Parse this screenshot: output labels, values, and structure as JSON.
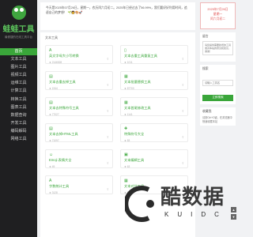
{
  "app": {
    "logo_text": "蛙蛙工具",
    "logo_sub": "最便捷的在线工具平台"
  },
  "sidebar": {
    "items": [
      {
        "label": "首页",
        "active": true
      },
      {
        "label": "文本工具"
      },
      {
        "label": "图片工具"
      },
      {
        "label": "视频工具"
      },
      {
        "label": "运维工具"
      },
      {
        "label": "计算工具"
      },
      {
        "label": "转换工具"
      },
      {
        "label": "图表工具"
      },
      {
        "label": "数据查询"
      },
      {
        "label": "开发工具"
      },
      {
        "label": "编码解码"
      },
      {
        "label": "网络工具"
      }
    ]
  },
  "notice": {
    "text": "今天是2025年07月26日，星期一，农历闰六月初二。2025年已经过去了56.99%，我们要好好利用时间，追逐自己的梦想！",
    "emoji": "🌱🧑🎨🚀"
  },
  "tools": {
    "section_title": "文本工具",
    "cards": [
      {
        "icon": "A",
        "icon_name": "font-icon",
        "title": "英文字母大小写转换",
        "stat": "★ 2146528"
      },
      {
        "icon": "▯",
        "icon_name": "document-icon",
        "title": "文本去重工具重复工具",
        "stat": "★ 1011"
      },
      {
        "icon": "▤",
        "icon_name": "list-icon",
        "title": "文本去重去掉工具",
        "stat": "★ 1944"
      },
      {
        "icon": "▦",
        "icon_name": "table-icon",
        "title": "文本批量替换工具",
        "stat": "★ 87700"
      },
      {
        "icon": "▤",
        "icon_name": "list-icon",
        "title": "文本去特殊符号工具",
        "stat": "★ 77027"
      },
      {
        "icon": "▦",
        "icon_name": "table-icon",
        "title": "文本首尾修改工具",
        "stat": "★ 1141"
      },
      {
        "icon": "▤",
        "icon_name": "list-icon",
        "title": "文本去掉HTML工具",
        "stat": "★ 71097"
      },
      {
        "icon": "✚",
        "icon_name": "plus-icon",
        "title": "特殊符号大全",
        "stat": "★ 83"
      },
      {
        "icon": "☺",
        "icon_name": "emoji-icon",
        "title": "Emoji 表情大全",
        "stat": "★ 49"
      },
      {
        "icon": "▣",
        "icon_name": "grid-icon",
        "title": "文本编辑工具",
        "stat": "★ 63"
      },
      {
        "icon": "A",
        "icon_name": "font-icon",
        "title": "字数统计工具",
        "stat": "★ 3128"
      },
      {
        "icon": "▦",
        "icon_name": "table-icon",
        "title": "文本对比工具",
        "stat": "★ 56"
      }
    ]
  },
  "right": {
    "date_line1": "2025年7月26日",
    "date_line2": "星期一",
    "date_line3": "闰六月初二",
    "feedback_title": "留言",
    "feedback_placeholder": "请您提供需要新增的工具或对本站的意见和建议，谢谢！",
    "search_title": "搜索",
    "search_placeholder": "请输入工具名",
    "search_button": "立即搜索",
    "fav_title": "收藏我",
    "fav_text": "请按Ctrl+D键，在浏览器中快速收藏本站"
  },
  "fab": {
    "up": "▲",
    "down": "▼"
  },
  "watermark": {
    "text": "酷数据",
    "sub": "KUIDC"
  }
}
